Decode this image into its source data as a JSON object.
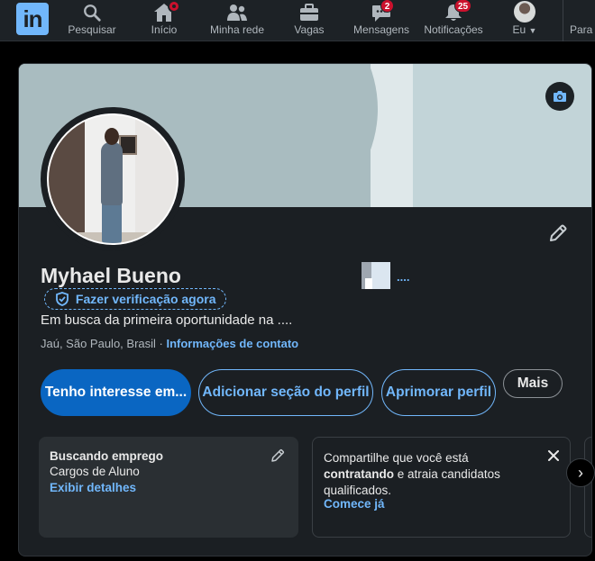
{
  "nav": {
    "logo": "in",
    "items": [
      {
        "label": "Pesquisar",
        "icon": "search-icon"
      },
      {
        "label": "Início",
        "icon": "home-icon"
      },
      {
        "label": "Minha rede",
        "icon": "network-icon"
      },
      {
        "label": "Vagas",
        "icon": "briefcase-icon"
      },
      {
        "label": "Mensagens",
        "icon": "messaging-icon",
        "badge": "2"
      },
      {
        "label": "Notificações",
        "icon": "bell-icon",
        "badge": "25"
      },
      {
        "label": "Eu",
        "icon": "avatar-icon"
      },
      {
        "label": "Para",
        "icon": "grid-icon"
      }
    ]
  },
  "profile": {
    "name": "Myhael Bueno",
    "verify_label": "Fazer verificação agora",
    "headline": "Em busca da primeira oportunidade na ....",
    "location": "Jaú, São Paulo, Brasil",
    "location_separator": " · ",
    "contact_link": "Informações de contato",
    "company_name": "....",
    "buttons": {
      "primary": "Tenho interesse em...",
      "add_section": "Adicionar seção do perfil",
      "enhance": "Aprimorar perfil",
      "more": "Mais"
    }
  },
  "panels": {
    "job_search": {
      "title": "Buscando emprego",
      "subtitle": "Cargos de Aluno",
      "link": "Exibir detalhes"
    },
    "hiring": {
      "text_start": "Compartilhe que você está ",
      "text_bold": "contratando",
      "text_end": " e atraia candidatos qualificados.",
      "link": "Comece já"
    }
  },
  "colors": {
    "accent": "#71b7fb",
    "primary_button": "#0a66c2",
    "badge": "#cb112d",
    "background": "#000000",
    "card": "#1b1f23"
  }
}
